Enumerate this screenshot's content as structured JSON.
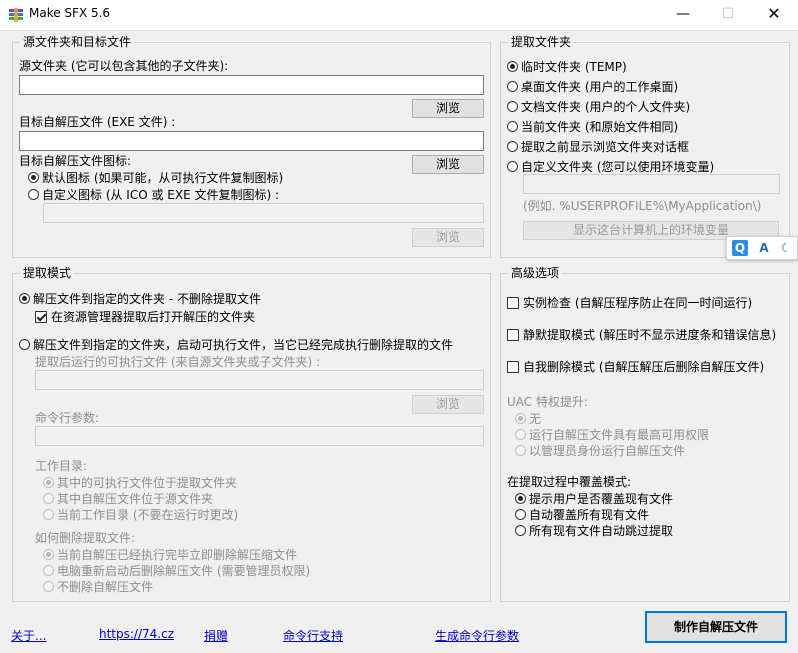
{
  "window": {
    "title": "Make SFX 5.6",
    "minimize_glyph": "—",
    "maximize_glyph": "☐",
    "close_glyph": "✕"
  },
  "source_group": {
    "title": "源文件夹和目标文件",
    "source_label": "源文件夹 (它可以包含其他的子文件夹):",
    "source_value": "",
    "browse1": "浏览",
    "target_label": "目标自解压文件 (EXE 文件) :",
    "target_value": "",
    "browse2": "浏览",
    "icon_label": "目标自解压文件图标:",
    "icon_default": "默认图标 (如果可能，从可执行文件复制图标)",
    "icon_custom": "自定义图标 (从 ICO 或 EXE 文件复制图标) :",
    "icon_path_value": "",
    "browse3": "浏览"
  },
  "extract_folder": {
    "title": "提取文件夹",
    "options": [
      "临时文件夹 (TEMP)",
      "桌面文件夹 (用户的工作桌面)",
      "文档文件夹 (用户的个人文件夹)",
      "当前文件夹 (和原始文件相同)",
      "提取之前显示浏览文件夹对话框",
      "自定义文件夹 (您可以使用环境变量)"
    ],
    "selected": 0,
    "custom_value": "",
    "example": "(例如. %USERPROFILE%\\MyApplication\\)",
    "env_button": "显示这台计算机上的环境变量"
  },
  "extract_mode": {
    "title": "提取模式",
    "mode1": "解压文件到指定的文件夹 - 不删除提取文件",
    "open_after": "在资源管理器提取后打开解压的文件夹",
    "mode2": "解压文件到指定的文件夹，启动可执行文件，当它已经完成执行删除提取的文件",
    "exe_label": "提取后运行的可执行文件 (来自源文件夹或子文件夹) :",
    "exe_value": "",
    "browse4": "浏览",
    "cmd_label": "命令行参数:",
    "cmd_value": "",
    "workdir_label": "工作目录:",
    "workdir_options": [
      "其中的可执行文件位于提取文件夹",
      "其中自解压文件位于源文件夹",
      "当前工作目录 (不要在运行时更改)"
    ],
    "delete_label": "如何删除提取文件:",
    "delete_options": [
      "当前自解压已经执行完毕立即删除解压缩文件",
      "电脑重新启动后删除解压文件 (需要管理员权限)",
      "不删除自解压文件"
    ]
  },
  "advanced": {
    "title": "高级选项",
    "single_instance": "实例检查 (自解压程序防止在同一时间运行)",
    "silent": "静默提取模式 (解压时不显示进度条和错误信息)",
    "self_delete": "自我删除模式 (自解压解压后删除自解压文件)",
    "uac_label": "UAC 特权提升:",
    "uac_options": [
      "无",
      "运行自解压文件具有最高可用权限",
      "以管理员身份运行自解压文件"
    ],
    "overwrite_label": "在提取过程中覆盖模式:",
    "overwrite_options": [
      "提示用户是否覆盖现有文件",
      "自动覆盖所有现有文件",
      "所有现有文件自动跳过提取"
    ]
  },
  "footer": {
    "about": "关于...",
    "website": "https://74.cz",
    "donate": "捐赠",
    "cmdline_support": "命令行支持",
    "gen_cmdline": "生成命令行参数",
    "make_button": "制作自解压文件"
  },
  "float_toolbar": {
    "q": "Q",
    "a": "A",
    "moon": "☾"
  },
  "colors": {
    "link": "#0000cc",
    "primary_border": "#0078d7"
  }
}
